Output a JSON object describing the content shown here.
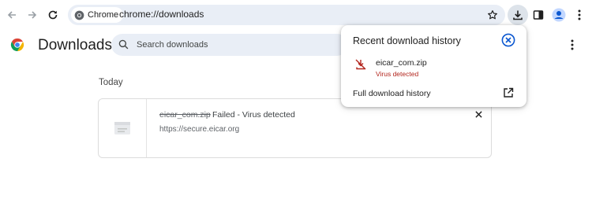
{
  "toolbar": {
    "chip_label": "Chrome",
    "url": "chrome://downloads"
  },
  "page": {
    "title": "Downloads",
    "search_placeholder": "Search downloads",
    "section_label": "Today"
  },
  "download_item": {
    "file_name": "eicar_com.zip",
    "status": "Failed - Virus detected",
    "source_url": "https://secure.eicar.org"
  },
  "bubble": {
    "title": "Recent download history",
    "item": {
      "name": "eicar_com.zip",
      "status": "Virus detected"
    },
    "history_link": "Full download history"
  },
  "colors": {
    "accent": "#0b57d0",
    "danger": "#b3261e",
    "omnibox": "#e9eef6"
  },
  "icons": [
    "back-arrow-icon",
    "forward-arrow-icon",
    "reload-icon",
    "chrome-icon",
    "star-icon",
    "download-icon",
    "side-panel-icon",
    "profile-icon",
    "more-vert-icon",
    "search-icon",
    "file-icon",
    "close-icon",
    "circle-close-icon",
    "blocked-download-icon",
    "open-in-new-icon"
  ]
}
